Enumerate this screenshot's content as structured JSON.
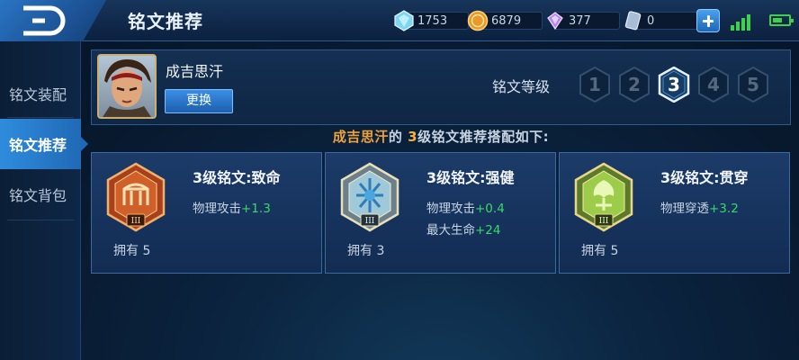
{
  "header": {
    "title": "铭文推荐",
    "currencies": [
      {
        "icon": "diamond-gem-icon",
        "value": "1753"
      },
      {
        "icon": "gold-coin-icon",
        "value": "6879"
      },
      {
        "icon": "purple-crystal-icon",
        "value": "377"
      },
      {
        "icon": "card-voucher-icon",
        "value": "0"
      }
    ]
  },
  "sidebar": {
    "items": [
      {
        "label": "铭文装配"
      },
      {
        "label": "铭文推荐"
      },
      {
        "label": "铭文背包"
      }
    ],
    "active_index": 1
  },
  "hero": {
    "name": "成吉思汗",
    "change_label": "更换"
  },
  "levels": {
    "label": "铭文等级",
    "options": [
      "1",
      "2",
      "3",
      "4",
      "5"
    ],
    "selected": "3"
  },
  "subtitle": {
    "hero": "成吉思汗",
    "middle": "的 ",
    "level": "3",
    "rest": "级铭文推荐搭配如下:"
  },
  "runes": [
    {
      "title": "3级铭文:致命",
      "color": "red",
      "tier": "III",
      "stats": [
        {
          "name": "物理攻击",
          "value": "+1.3"
        }
      ],
      "owned": "拥有 5"
    },
    {
      "title": "3级铭文:强健",
      "color": "blue",
      "tier": "III",
      "stats": [
        {
          "name": "物理攻击",
          "value": "+0.4"
        },
        {
          "name": "最大生命",
          "value": "+24"
        }
      ],
      "owned": "拥有 3"
    },
    {
      "title": "3级铭文:贯穿",
      "color": "green",
      "tier": "III",
      "stats": [
        {
          "name": "物理穿透",
          "value": "+3.2"
        }
      ],
      "owned": "拥有 5"
    }
  ],
  "colors": {
    "accent_blue": "#2f8cdd",
    "highlight_orange": "#f0a23a",
    "stat_green": "#38d86a"
  }
}
